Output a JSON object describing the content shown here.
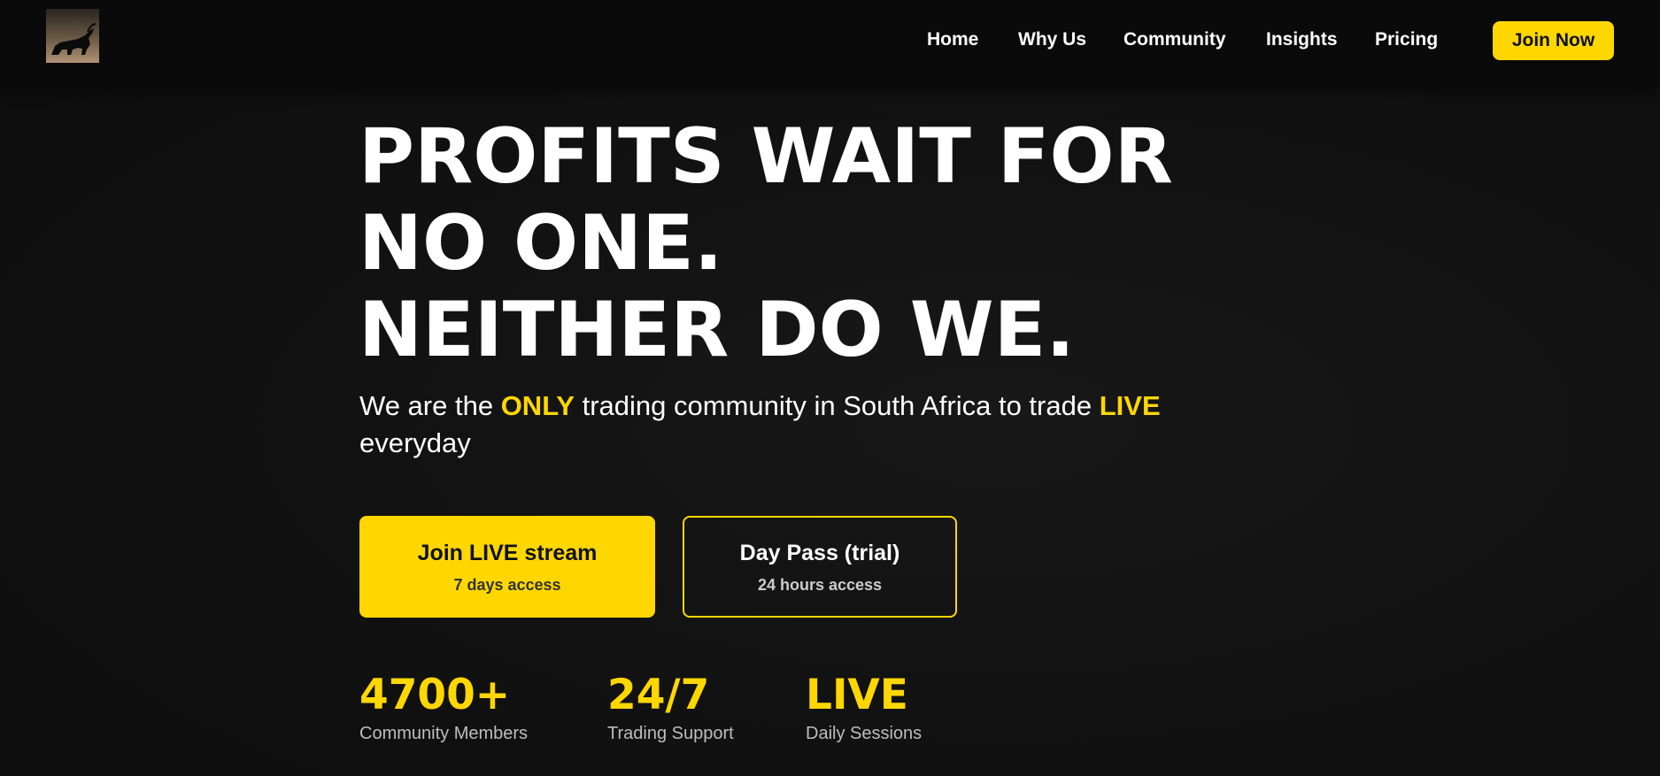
{
  "nav": {
    "logo_name": "bull-logo",
    "links": [
      "Home",
      "Why Us",
      "Community",
      "Insights",
      "Pricing"
    ],
    "cta": "Join Now"
  },
  "hero": {
    "title_lines": [
      "PROFITS WAIT FOR",
      "NO ONE.",
      "NEITHER DO WE."
    ],
    "subtitle": {
      "part1": "We are the ",
      "highlight1": "ONLY",
      "part2": " trading community in South Africa to trade ",
      "highlight2": "LIVE",
      "part3": " everyday"
    }
  },
  "cta_buttons": {
    "primary": {
      "label": "Join LIVE stream",
      "sub": "7 days access"
    },
    "secondary": {
      "label": "Day Pass (trial)",
      "sub": "24 hours access"
    }
  },
  "stats": [
    {
      "value": "4700+",
      "label": "Community Members"
    },
    {
      "value": "24/7",
      "label": "Trading Support"
    },
    {
      "value": "LIVE",
      "label": "Daily Sessions"
    }
  ],
  "colors": {
    "accent": "#FFD700",
    "background": "#111111",
    "navbar": "#0a0a0a",
    "text": "#ffffff"
  }
}
